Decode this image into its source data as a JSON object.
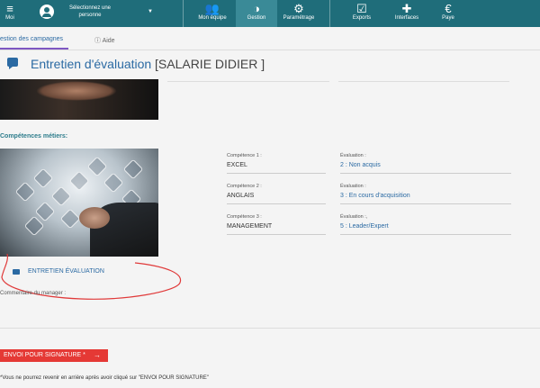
{
  "nav": {
    "moi": "Moi",
    "person": "Sélectionnez une personne",
    "items": [
      {
        "icon": "group-icon",
        "glyph": "👥",
        "label": "Mon équipe"
      },
      {
        "icon": "chart-icon",
        "glyph": "◑",
        "label": "Gestion"
      },
      {
        "icon": "gear-icon",
        "glyph": "⚙",
        "label": "Paramétrage"
      },
      {
        "icon": "export-icon",
        "glyph": "☑",
        "label": "Exports"
      },
      {
        "icon": "puzzle-icon",
        "glyph": "✚",
        "label": "Interfaces"
      },
      {
        "icon": "euro-icon",
        "glyph": "€",
        "label": "Paye"
      }
    ],
    "brand_color": "#1f6d7a"
  },
  "tabs": {
    "campaigns": "estion des campagnes",
    "help": "Aide"
  },
  "page": {
    "title": "Entretien d'évaluation",
    "subtitle": "[SALARIE DIDIER ]"
  },
  "section": {
    "title": "Compétences métiers:"
  },
  "competences": [
    {
      "label": "Compétence 1 :",
      "value": "EXCEL",
      "eval_label": "Évaluation :",
      "eval_value": "2 : Non acquis"
    },
    {
      "label": "Compétence 2 :",
      "value": "ANGLAIS",
      "eval_label": "Évaluation :",
      "eval_value": "3 : En cours d'acquisition"
    },
    {
      "label": "Compétence 3 :",
      "value": "MANAGEMENT",
      "eval_label": "Évaluation :,",
      "eval_value": "5 : Leader/Expert"
    }
  ],
  "actions": {
    "print_link": "ENTRETIEN ÉVALUATION",
    "comment_label": "Commentaire du manager :",
    "submit_button": "ENVOI POUR SIGNATURE *",
    "note": "*Vous ne pourrez revenir en arrière après avoir cliqué sur \"ENVOI POUR SIGNATURE\""
  },
  "colors": {
    "accent": "#2b6aa3",
    "danger": "#e53935",
    "tab_underline": "#7e57c2",
    "annotation": "#e03a3a"
  }
}
